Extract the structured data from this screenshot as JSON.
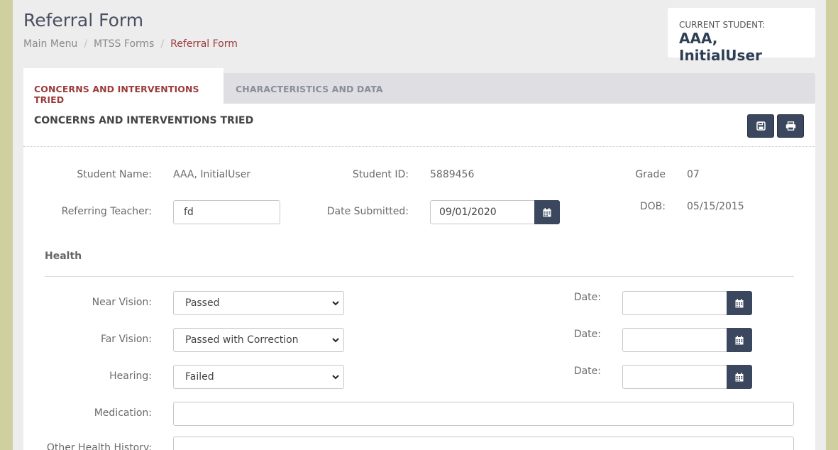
{
  "header": {
    "title": "Referral Form",
    "breadcrumb": [
      "Main Menu",
      "MTSS Forms",
      "Referral Form"
    ],
    "current_student_label": "CURRENT STUDENT:",
    "current_student_name": "AAA, InitialUser"
  },
  "tabs": [
    {
      "label": "CONCERNS AND INTERVENTIONS TRIED",
      "active": true
    },
    {
      "label": "CHARACTERISTICS AND DATA",
      "active": false
    }
  ],
  "panel": {
    "title": "CONCERNS AND INTERVENTIONS TRIED",
    "save_icon": "save-icon",
    "print_icon": "print-icon"
  },
  "form": {
    "student_name_label": "Student Name:",
    "student_name": "AAA, InitialUser",
    "student_id_label": "Student ID:",
    "student_id": "5889456",
    "grade_label": "Grade",
    "grade": "07",
    "referring_teacher_label": "Referring Teacher:",
    "referring_teacher": "fd",
    "date_submitted_label": "Date Submitted:",
    "date_submitted": "09/01/2020",
    "dob_label": "DOB:",
    "dob": "05/15/2015"
  },
  "health": {
    "title": "Health",
    "near_vision_label": "Near Vision:",
    "near_vision": "Passed",
    "far_vision_label": "Far Vision:",
    "far_vision": "Passed with Correction",
    "hearing_label": "Hearing:",
    "hearing": "Failed",
    "date_label": "Date:",
    "near_date": "",
    "far_date": "",
    "hearing_date": "",
    "medication_label": "Medication:",
    "medication": "",
    "other_history_label": "Other Health History:",
    "other_history": ""
  },
  "colors": {
    "accent": "#9b3b3b",
    "dark_button": "#3b475e",
    "outer_background": "#cfcfa0"
  }
}
